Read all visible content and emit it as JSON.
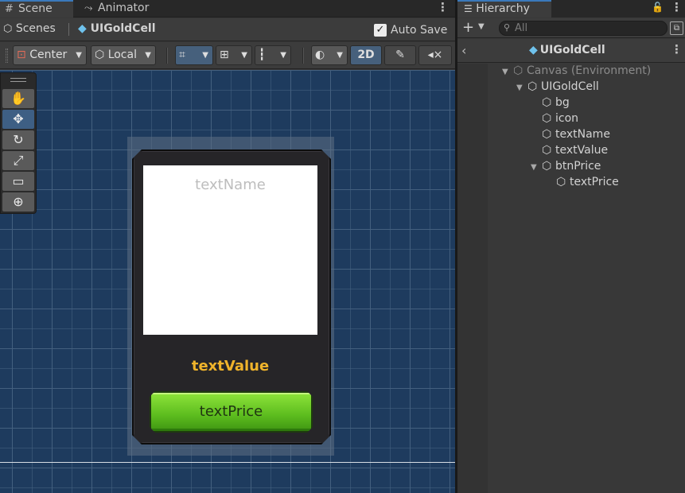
{
  "scene_tabs": [
    {
      "label": "Scene",
      "icon": "grid-icon"
    },
    {
      "label": "Animator",
      "icon": "animator-icon"
    }
  ],
  "breadcrumb": {
    "root": "Scenes",
    "current": "UIGoldCell"
  },
  "autosave": {
    "label": "Auto Save",
    "checked": true
  },
  "toolbar": {
    "pivot_label": "Center",
    "space_label": "Local",
    "mode_2d_label": "2D"
  },
  "scene_content": {
    "text_name": "textName",
    "text_value": "textValue",
    "text_price": "textPrice"
  },
  "hierarchy": {
    "tab_label": "Hierarchy",
    "search_placeholder": "All",
    "header_title": "UIGoldCell",
    "items": [
      {
        "label": "Canvas (Environment)",
        "depth": 0,
        "expanded": true,
        "dim": true
      },
      {
        "label": "UIGoldCell",
        "depth": 1,
        "expanded": true,
        "dim": false
      },
      {
        "label": "bg",
        "depth": 2,
        "expanded": null,
        "dim": false
      },
      {
        "label": "icon",
        "depth": 2,
        "expanded": null,
        "dim": false
      },
      {
        "label": "textName",
        "depth": 2,
        "expanded": null,
        "dim": false
      },
      {
        "label": "textValue",
        "depth": 2,
        "expanded": null,
        "dim": false
      },
      {
        "label": "btnPrice",
        "depth": 2,
        "expanded": true,
        "dim": false
      },
      {
        "label": "textPrice",
        "depth": 3,
        "expanded": null,
        "dim": false
      }
    ]
  },
  "colors": {
    "accent": "#3a79bb",
    "scene_bg": "#1e3b5e",
    "gold_text": "#f0b42b",
    "button_green": "#6ccb2a",
    "prefab_cube": "#6fc2ec"
  }
}
